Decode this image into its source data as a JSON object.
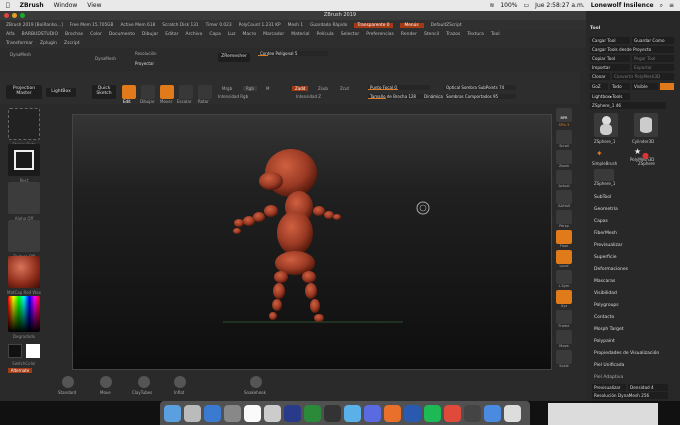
{
  "menubar": {
    "app": "ZBrush",
    "items": [
      "Window",
      "View"
    ],
    "battery": "100%",
    "datetime": "Jue 2:58:27 a.m.",
    "user": "Lonewolf Insilence"
  },
  "zbrush": {
    "title": "ZBrush 2019",
    "info": {
      "doc": "ZBrush 2019 [BoiRanho...]",
      "free_mem": "Free Mem 15.705GB",
      "active_mem": "Active Mem 618",
      "scratch": "Scratch Disk 131",
      "timer": "Timer 0.023",
      "polycount": "PolyCount 1.231 KP",
      "mesh": "Mesh 1",
      "autosave": "Guardado Rápido",
      "transparent_label": "Transparente",
      "transparent_value": "0",
      "menus_btn": "Menús",
      "script": "DefaultZScript"
    },
    "menus1": [
      "Alfa",
      "BARBUDSTUDIO",
      "Brochas",
      "Color",
      "Documento",
      "Dibujar",
      "Editar",
      "Archivo",
      "Capa",
      "Luz",
      "Macro",
      "Marcador",
      "Material",
      "Película",
      "Selector",
      "Preferencias",
      "Render",
      "Stencil",
      "Trazos",
      "Textura",
      "Tool"
    ],
    "menus2": [
      "Transformar",
      "Zplugin",
      "Zscript"
    ],
    "quick": {
      "dynamesh": "DynaMesh",
      "resolution": "Resolución",
      "proyect": "Proyectar",
      "zremesher": "ZRemesher",
      "target": "Conteo Polígonal 5"
    },
    "toolbar": {
      "projection_master": "Projection Master",
      "lightbox": "LightBox",
      "quick_sketch": "Quick Sketch",
      "edit": "Edit",
      "draw": "Dibujar",
      "move": "Mover",
      "scale": "Escalar",
      "rotate": "Rotar",
      "mrgb": "Mrgb",
      "rgb": "Rgb",
      "m": "M",
      "zadd": "Zadd",
      "zsub": "Zsub",
      "zcut": "Zcut",
      "rgb_intensity": "Intensidad Rgb",
      "z_intensity": "Intensidad Z",
      "focal_shift": "Punto Focal",
      "focal_value": "0",
      "draw_size": "Tamaño de Brocha",
      "draw_size_value": "128",
      "dynamic": "Dinámica",
      "active_points": "Optical Sombra SubPoints",
      "active_points_value": "74",
      "total_points": "Sombras Comportados",
      "total_points_value": "95"
    },
    "left": {
      "stroke": "Stroke Dots",
      "alpha": "Rect",
      "alpha_off": "Alpha Off",
      "texture_off": "Texture Off",
      "material": "MatCap Red Wax",
      "gradient": "Degradado",
      "switch_color": "SwitchColor",
      "alternate": "Alternate"
    },
    "right": [
      "BPR",
      "SPix 3",
      "Scroll",
      "Zoom",
      "Actual",
      "AAHalf",
      "Persp",
      "Floor",
      "Local",
      "L.Sym",
      "Xyz",
      "Frame",
      "Move",
      "Scale",
      "Rotate",
      "PolyF",
      "Transp",
      "Ghost",
      "Solo"
    ],
    "bottom": [
      "Standard",
      "Move",
      "ClayTubes",
      "Inflat",
      "Snakehook"
    ],
    "tray": {
      "title": "Tool",
      "load": "Cargar Tool",
      "save": "Guardar Como",
      "load_project": "Cargar Tools desde Proyecto",
      "copy": "Copiar Tool",
      "paste": "Pegar Tool",
      "import": "Importar",
      "export": "Exportar",
      "clone": "Clonar",
      "make_polymesh": "Convertir PolyMesh3D",
      "goz": "GoZ",
      "all": "Todo",
      "visible": "Visible",
      "lightbox_tools": "Lightbox▸Tools",
      "current_tool": "ZSphere_1",
      "current_value": "46",
      "tools": [
        {
          "name": "ZSphere_1"
        },
        {
          "name": "Cylinder3D"
        },
        {
          "name": "PolyMesh3D"
        },
        {
          "name": "SimpleBrush"
        },
        {
          "name": "ZSphere"
        },
        {
          "name": "ZSphere_1"
        }
      ],
      "subpalettes": [
        "SubTool",
        "Geometría",
        "Capas",
        "FiberMesh",
        "Previsualizar",
        "Superficie",
        "Deformaciones",
        "Mascaras",
        "Visibilidad",
        "Polygroups",
        "Contacto",
        "Morph Target",
        "Polypaint",
        "Propiedades de Visualización",
        "Piel Unificada",
        "Piel Adaptiva"
      ],
      "preview": "Previsualizar",
      "density": "Densidad",
      "density_value": "4",
      "resolution": "Resolución DynaMesh",
      "resolution_value": "256"
    }
  },
  "colors": {
    "accent": "#e07a1a",
    "badge": "#a33a14",
    "figure": "#9a3a24"
  }
}
